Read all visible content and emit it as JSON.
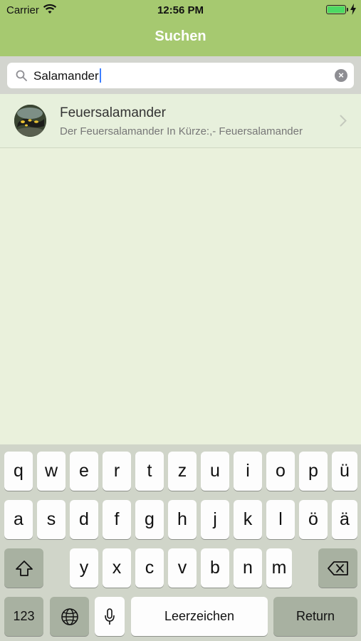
{
  "status_bar": {
    "carrier": "Carrier",
    "time": "12:56 PM"
  },
  "nav": {
    "title": "Suchen"
  },
  "search": {
    "value": "Salamander",
    "clear_icon": "×"
  },
  "results": [
    {
      "title": "Feuersalamander",
      "subtitle": "Der Feuersalamander In Kürze:,- Feuersalamander"
    }
  ],
  "keyboard": {
    "row1": [
      "q",
      "w",
      "e",
      "r",
      "t",
      "z",
      "u",
      "i",
      "o",
      "p",
      "ü"
    ],
    "row2": [
      "a",
      "s",
      "d",
      "f",
      "g",
      "h",
      "j",
      "k",
      "l",
      "ö",
      "ä"
    ],
    "row3": [
      "y",
      "x",
      "c",
      "v",
      "b",
      "n",
      "m"
    ],
    "numbers_label": "123",
    "space_label": "Leerzeichen",
    "return_label": "Return"
  },
  "colors": {
    "nav_bg": "#a6c970",
    "content_bg": "#eaf1dc",
    "keyboard_bg": "#d0d5c9",
    "dark_key": "#a8b1a1"
  }
}
